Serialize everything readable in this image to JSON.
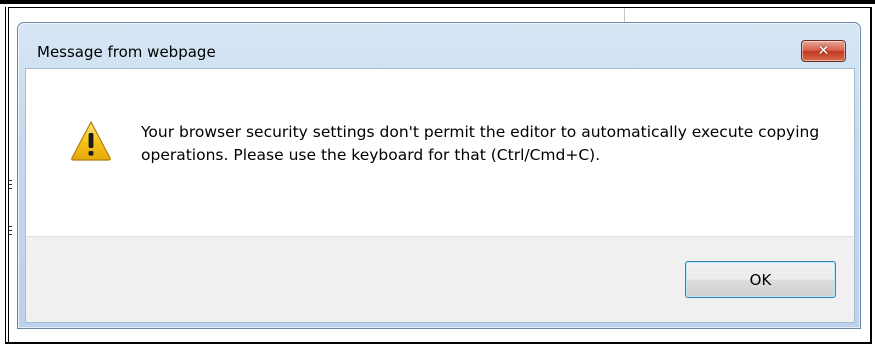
{
  "dialog": {
    "title": "Message from webpage",
    "close_symbol": "✕",
    "icon": "warning-icon",
    "message": "Your browser security settings don't permit the editor to automatically execute copying operations. Please use the keyboard for that (Ctrl/Cmd+C).",
    "ok_label": "OK"
  },
  "colors": {
    "frame": "#bcd2ea",
    "close_button": "#c2361f",
    "warning_fill": "#f5c518",
    "ok_border": "#3c7fb1"
  }
}
